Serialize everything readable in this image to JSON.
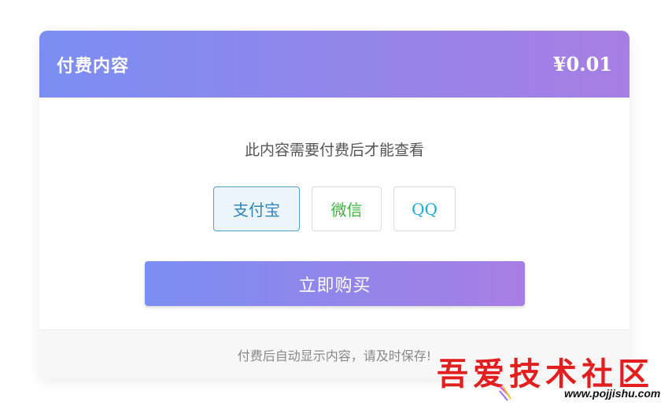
{
  "card": {
    "title": "付费内容",
    "price": "¥0.01",
    "notice": "此内容需要付费后才能查看",
    "methods": [
      {
        "label": "支付宝",
        "selected": true
      },
      {
        "label": "微信",
        "selected": false
      },
      {
        "label": "QQ",
        "selected": false
      }
    ],
    "buy_label": "立即购买",
    "footer_text": "付费后自动显示内容，请及时保存!"
  },
  "watermark": {
    "text": "吾爱技术社区",
    "url": "www.pojjishu.com"
  },
  "colors": {
    "gradient_start": "#7b8ef2",
    "gradient_end": "#a77ee3",
    "alipay": "#2f85c2",
    "wechat": "#3fb33f",
    "qq": "#1aa9d6",
    "watermark": "#e11f1f"
  }
}
